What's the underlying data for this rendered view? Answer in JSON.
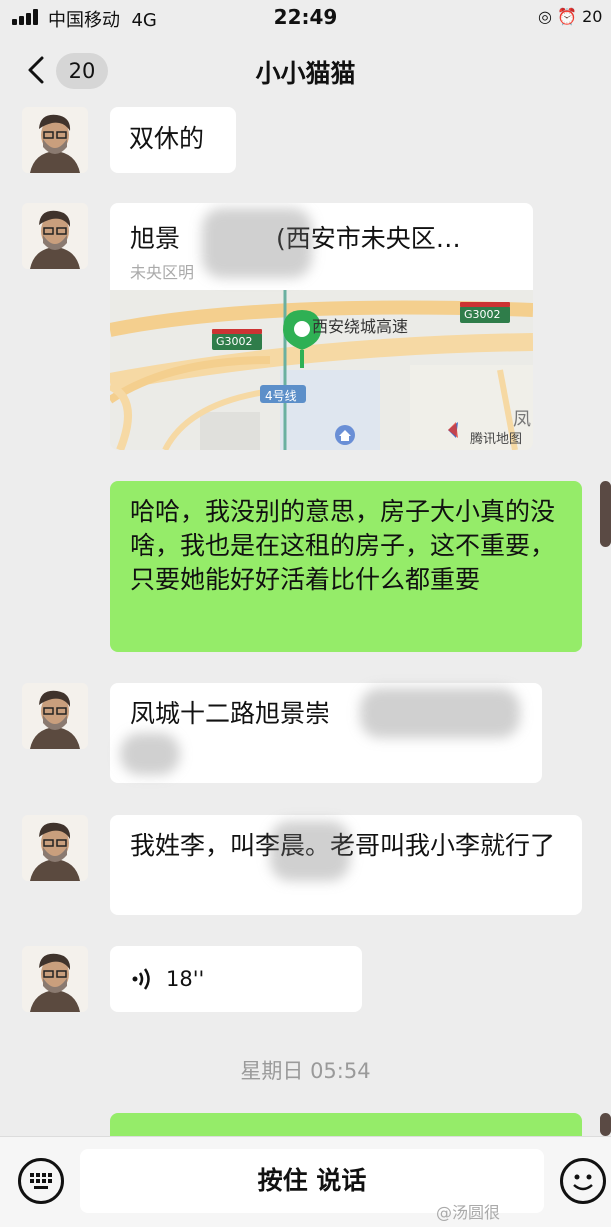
{
  "status_bar": {
    "carrier": "中国移动",
    "network": "4G",
    "time": "22:49",
    "battery": "20"
  },
  "nav": {
    "back_count": "20",
    "title": "小小猫猫"
  },
  "messages": [
    {
      "text": "双休的"
    },
    {
      "title": "旭景",
      "address": "西安市未央区…",
      "subtitle": "未央区明",
      "map_labels": {
        "road": "西安绕城高速",
        "shield_left": "G3002",
        "shield_right": "G3002",
        "metro": "4号线",
        "provider": "腾讯地图",
        "edge_char": "凤"
      }
    },
    {
      "text": "哈哈，我没别的意思，房子大小真的没啥，我也是在这租的房子，这不重要，只要她能好好活着比什么都重要"
    },
    {
      "text": "凤城十二路旭景崇"
    },
    {
      "text": "我姓李，叫李晨。老哥叫我小李就行了"
    },
    {
      "duration": "18''"
    }
  ],
  "timestamp": "星期日 05:54",
  "input_bar": {
    "hold_to_talk": "按住 说话"
  },
  "watermark": "@汤圆很"
}
